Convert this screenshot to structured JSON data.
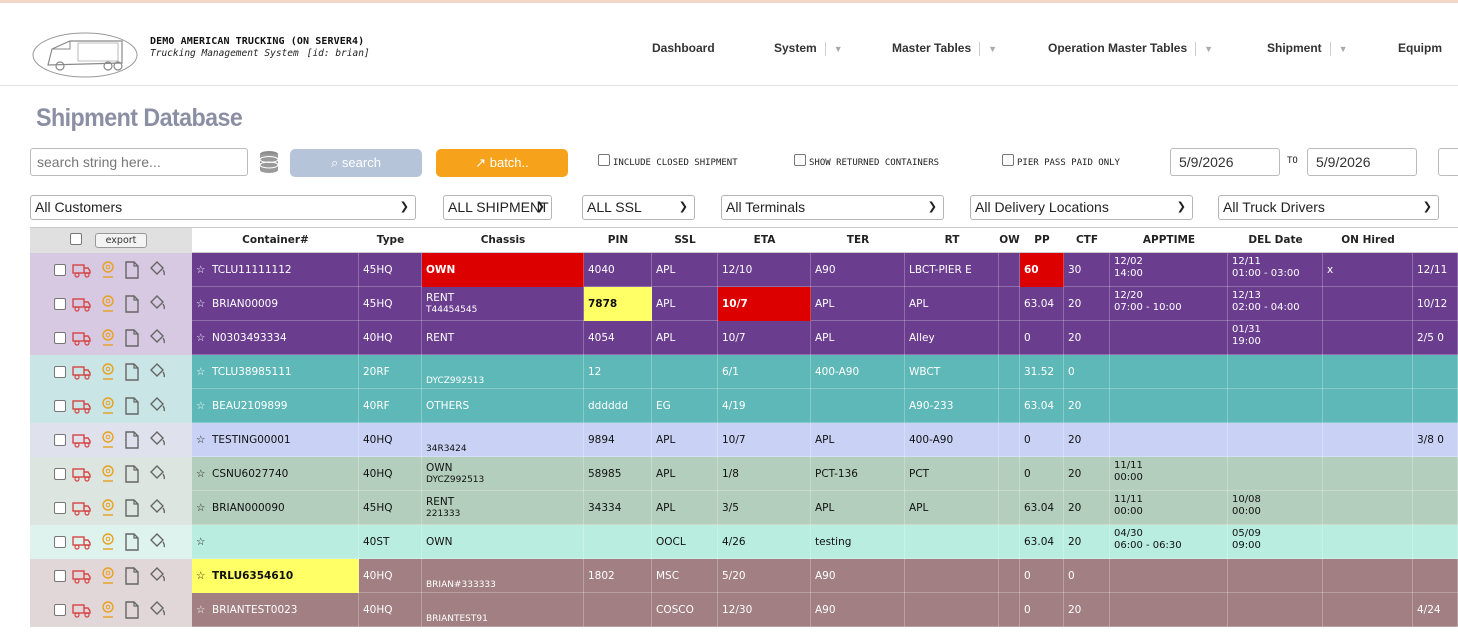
{
  "header": {
    "company": "DEMO AMERICAN TRUCKING (ON SERVER4)",
    "subtitle": "Trucking Management System",
    "user_id": "[id: brian]",
    "nav": [
      {
        "label": "Dashboard"
      },
      {
        "label": "System"
      },
      {
        "label": "Master Tables"
      },
      {
        "label": "Operation Master Tables"
      },
      {
        "label": "Shipment"
      },
      {
        "label": "Equipm"
      }
    ]
  },
  "page_title": "Shipment Database",
  "toolbar": {
    "search_placeholder": "search string here...",
    "search_label": "⌕ search",
    "batch_label": "↗ batch..",
    "include_closed": "INCLUDE CLOSED SHIPMENT",
    "show_returned": "SHOW RETURNED CONTAINERS",
    "pier_pass": "PIER PASS PAID ONLY",
    "date_from": "5/9/2026",
    "to_label": "TO",
    "date_to": "5/9/2026"
  },
  "filters": {
    "customers": "All Customers",
    "shipment": "ALL SHIPMENT",
    "ssl": "ALL SSL",
    "terminals": "All Terminals",
    "delivery": "All Delivery Locations",
    "drivers": "All Truck Drivers"
  },
  "table": {
    "export_label": "export",
    "headers": [
      "Container#",
      "Type",
      "Chassis",
      "PIN",
      "SSL",
      "ETA",
      "TER",
      "RT",
      "OW",
      "PP",
      "CTF",
      "APPTIME",
      "DEL Date",
      "ON Hired"
    ],
    "rows": [
      {
        "container": "TCLU11111112",
        "type": "45HQ",
        "chassis": "OWN",
        "chassis2": "",
        "pin": "4040",
        "ssl": "APL",
        "eta": "12/10",
        "ter": "A90",
        "rt": "LBCT-PIER E",
        "ow": "",
        "pp": "60",
        "ctf": "30",
        "appt1": "12/02",
        "appt2": "14:00",
        "del1": "12/11",
        "del2": "01:00 - 03:00",
        "onhired": "x",
        "extra": "12/11"
      },
      {
        "container": "BRIAN00009",
        "type": "45HQ",
        "chassis": "RENT",
        "chassis2": "T44454545",
        "pin": "7878",
        "ssl": "APL",
        "eta": "10/7",
        "ter": "APL",
        "rt": "APL",
        "ow": "",
        "pp": "63.04",
        "ctf": "20",
        "appt1": "12/20",
        "appt2": "07:00 - 10:00",
        "del1": "12/13",
        "del2": "02:00 - 04:00",
        "onhired": "",
        "extra": "10/12"
      },
      {
        "container": "N0303493334",
        "type": "40HQ",
        "chassis": "RENT",
        "chassis2": "",
        "pin": "4054",
        "ssl": "APL",
        "eta": "10/7",
        "ter": "APL",
        "rt": "Alley",
        "ow": "",
        "pp": "0",
        "ctf": "20",
        "appt1": "",
        "appt2": "",
        "del1": "01/31",
        "del2": "19:00",
        "onhired": "",
        "extra": "2/5 0"
      },
      {
        "container": "TCLU38985111",
        "type": "20RF",
        "chassis": "",
        "chassis2": "DYCZ992513",
        "pin": "12",
        "ssl": "",
        "eta": "6/1",
        "ter": "400-A90",
        "rt": "WBCT",
        "ow": "",
        "pp": "31.52",
        "ctf": "0",
        "appt1": "",
        "appt2": "",
        "del1": "",
        "del2": "",
        "onhired": "",
        "extra": ""
      },
      {
        "container": "BEAU2109899",
        "type": "40RF",
        "chassis": "OTHERS",
        "chassis2": "",
        "pin": "dddddd",
        "ssl": "EG",
        "eta": "4/19",
        "ter": "",
        "rt": "A90-233",
        "ow": "",
        "pp": "63.04",
        "ctf": "20",
        "appt1": "",
        "appt2": "",
        "del1": "",
        "del2": "",
        "onhired": "",
        "extra": ""
      },
      {
        "container": "TESTING00001",
        "type": "40HQ",
        "chassis": "",
        "chassis2": "34R3424",
        "pin": "9894",
        "ssl": "APL",
        "eta": "10/7",
        "ter": "APL",
        "rt": "400-A90",
        "ow": "",
        "pp": "0",
        "ctf": "20",
        "appt1": "",
        "appt2": "",
        "del1": "",
        "del2": "",
        "onhired": "",
        "extra": "3/8 0"
      },
      {
        "container": "CSNU6027740",
        "type": "40HQ",
        "chassis": "OWN",
        "chassis2": "DYCZ992513",
        "pin": "58985",
        "ssl": "APL",
        "eta": "1/8",
        "ter": "PCT-136",
        "rt": "PCT",
        "ow": "",
        "pp": "0",
        "ctf": "20",
        "appt1": "11/11",
        "appt2": "00:00",
        "del1": "",
        "del2": "",
        "onhired": "",
        "extra": ""
      },
      {
        "container": "BRIAN000090",
        "type": "45HQ",
        "chassis": "RENT",
        "chassis2": "221333",
        "pin": "34334",
        "ssl": "APL",
        "eta": "3/5",
        "ter": "APL",
        "rt": "APL",
        "ow": "",
        "pp": "63.04",
        "ctf": "20",
        "appt1": "11/11",
        "appt2": "00:00",
        "del1": "10/08",
        "del2": "00:00",
        "onhired": "",
        "extra": ""
      },
      {
        "container": "",
        "type": "40ST",
        "chassis": "OWN",
        "chassis2": "",
        "pin": "",
        "ssl": "OOCL",
        "eta": "4/26",
        "ter": "testing",
        "rt": "",
        "ow": "",
        "pp": "63.04",
        "ctf": "20",
        "appt1": "04/30",
        "appt2": "06:00 - 06:30",
        "del1": "05/09",
        "del2": "09:00",
        "onhired": "",
        "extra": ""
      },
      {
        "container": "TRLU6354610",
        "type": "40HQ",
        "chassis": "",
        "chassis2": "BRIAN#333333",
        "pin": "1802",
        "ssl": "MSC",
        "eta": "5/20",
        "ter": "A90",
        "rt": "",
        "ow": "",
        "pp": "0",
        "ctf": "0",
        "appt1": "",
        "appt2": "",
        "del1": "",
        "del2": "",
        "onhired": "",
        "extra": ""
      },
      {
        "container": "BRIANTEST0023",
        "type": "40HQ",
        "chassis": "",
        "chassis2": "BRIANTEST91",
        "pin": "",
        "ssl": "COSCO",
        "eta": "12/30",
        "ter": "A90",
        "rt": "",
        "ow": "",
        "pp": "0",
        "ctf": "20",
        "appt1": "",
        "appt2": "",
        "del1": "",
        "del2": "",
        "onhired": "",
        "extra": "4/24"
      }
    ]
  },
  "colors": {
    "purple": "#6a3d8f",
    "teal": "#5fb8b8",
    "lavender": "#c9d2f5",
    "sage": "#b4cebd",
    "mint": "#b9ede0",
    "mauve": "#a17f82",
    "red": "#dd0000",
    "yellow": "#ffff66",
    "icon_red": "#d64545",
    "icon_orange": "#e8a020"
  }
}
